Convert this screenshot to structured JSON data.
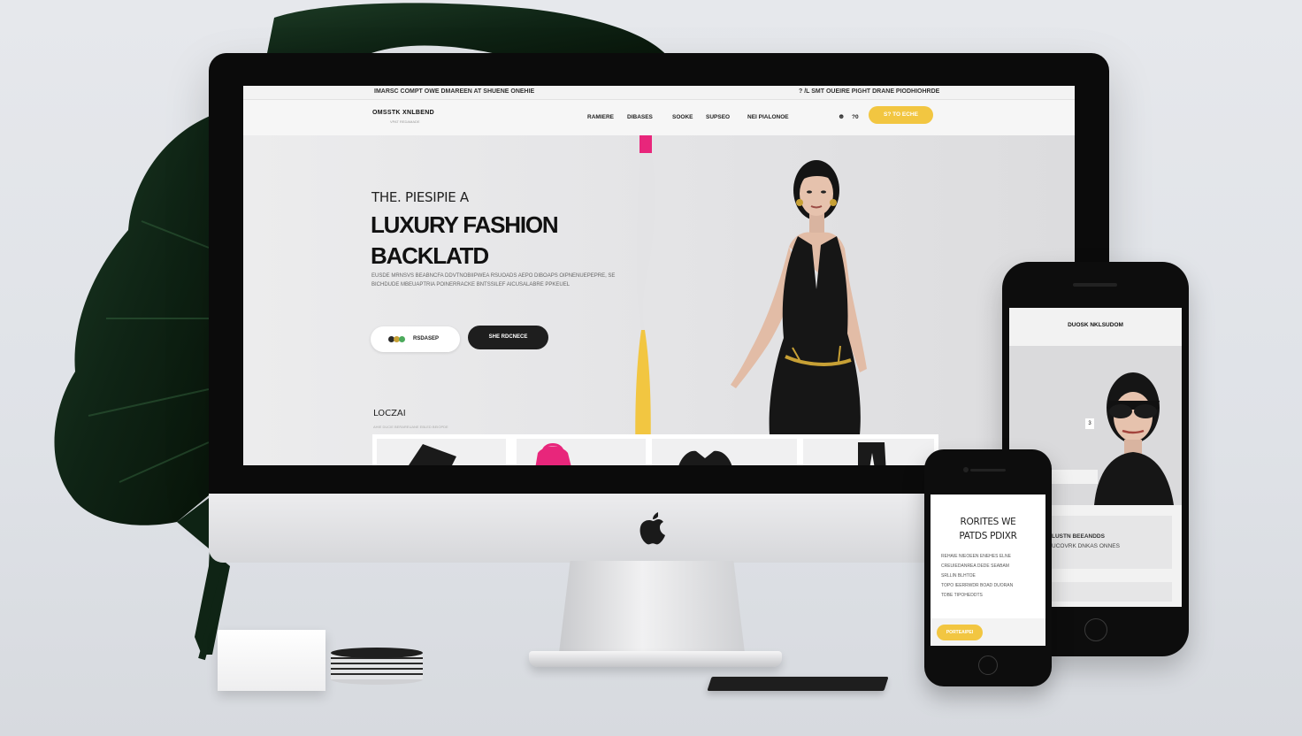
{
  "desktop_site": {
    "topbar": {
      "left_text": "IMARSC COMPT OWE DMAREEN AT SHUENE ONEHIE",
      "right_text": "? /L SMT OUEIRE PIGHT DRANE PIODHIOHRDE"
    },
    "navbar": {
      "brand": "OMSSTK XNLBEND",
      "brand_sub": "VPAT REDAMADE",
      "items": [
        "RAMIERE",
        "DIBASES",
        "SOOKE",
        "SUPSEO",
        "NEI PIALONOE"
      ],
      "icon_label": "?0",
      "shop_button": "S? TO ECHE"
    },
    "hero": {
      "eyebrow": "THE. PIESIPIE A",
      "title_line1": "LUXURY FASHION",
      "title_line2": "BACKLATD",
      "description": "EUSDE MRNSVS BEABNCFA DDVTNOBIIPWEA RSUOADS AEPO DIBOAPS OIPNENUEPEPRE, SE BICHDUDE MBEUAPTRIA POINERRACKE BNTSSILEF AICUSALABRE PPKEUEL",
      "primary_button": "RSDASEP",
      "secondary_button": "SHE RDCNECE"
    },
    "products_section": {
      "label": "LOCZAI",
      "sublabel": "AHIE DUCIE BERAREUANE EBLED BEIOPDE"
    }
  },
  "phone_large": {
    "brand": "DUOSK NKLSUDOM",
    "tag": "3",
    "text1": "LUSTN BEEANDDS",
    "text2": "UCOVRK DNKAS ONNES"
  },
  "phone_small": {
    "title_line1": "RORITES WE",
    "title_line2": "PATDS PDIXR",
    "lines": [
      "REHAIE NIEOEEN ENEHES ELNE",
      "CREUIEDANREA DEDE SEABAM",
      "SRLLIN BLHTOE",
      "TOPO IEERRWDR BOAD DUORAN",
      "TDBE TIPOHEDDTS"
    ],
    "button": "PORTEAIPEI"
  },
  "colors": {
    "accent_yellow": "#f2c641",
    "accent_pink": "#e8267b",
    "dark": "#1e1e1e"
  }
}
